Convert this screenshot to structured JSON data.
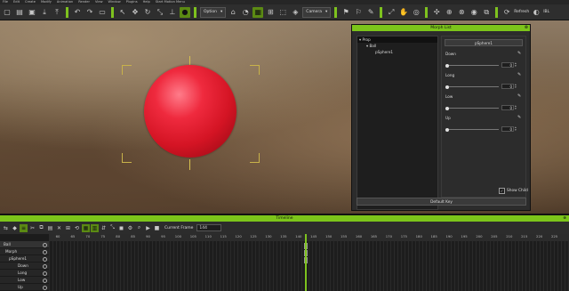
{
  "menu": [
    "File",
    "Edit",
    "Create",
    "Modify",
    "Animation",
    "Render",
    "View",
    "Window",
    "Plugins",
    "Help",
    "Start Motion Menu"
  ],
  "toolbar": {
    "view_combo": "Option",
    "camera_combo": "Camera",
    "refresh": "Refresh",
    "ibl": "IBL"
  },
  "morph_list": {
    "title": "Morph List",
    "tree": [
      {
        "label": "Prop",
        "level": 0
      },
      {
        "label": "Ball",
        "level": 1
      },
      {
        "label": "pSphere1",
        "level": 2
      }
    ],
    "object_button": "pSphere1",
    "morphs": [
      {
        "label": "Down",
        "value": "0"
      },
      {
        "label": "Long",
        "value": "0"
      },
      {
        "label": "Low",
        "value": "0"
      },
      {
        "label": "Up",
        "value": "0"
      }
    ],
    "show_child": "Show Child",
    "default_key": "Default Key"
  },
  "timeline": {
    "title": "Timeline",
    "current_frame_label": "Current Frame",
    "current_frame_value": "144",
    "ruler": [
      "60",
      "65",
      "70",
      "75",
      "80",
      "85",
      "90",
      "95",
      "100",
      "105",
      "110",
      "115",
      "120",
      "125",
      "130",
      "135",
      "140",
      "145",
      "150",
      "155",
      "160",
      "165",
      "170",
      "175",
      "180",
      "185",
      "190",
      "195",
      "200",
      "205",
      "210",
      "215",
      "220",
      "225"
    ],
    "tracks": [
      "Ball",
      "Morph",
      "pSphere1",
      "Down",
      "Long",
      "Low",
      "Up"
    ]
  }
}
